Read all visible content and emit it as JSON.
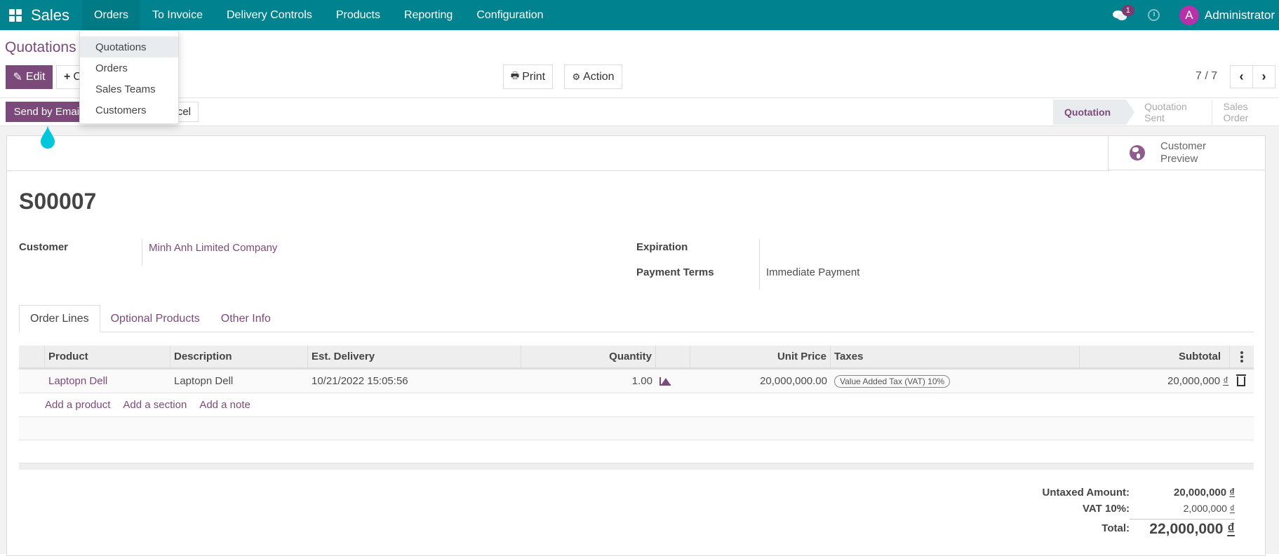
{
  "navbar": {
    "app_name": "Sales",
    "menus": [
      "Orders",
      "To Invoice",
      "Delivery Controls",
      "Products",
      "Reporting",
      "Configuration"
    ],
    "active_menu": "Orders",
    "chat_badge": "1",
    "user_initial": "A",
    "user_name": "Administrator"
  },
  "dropdown": {
    "items": [
      "Quotations",
      "Orders",
      "Sales Teams",
      "Customers"
    ],
    "highlighted": "Quotations"
  },
  "control_panel": {
    "breadcrumb": "Quotations /",
    "edit_label": "Edit",
    "create_label": "C",
    "print_label": "Print",
    "action_label": "Action",
    "pager": "7 / 7"
  },
  "statusbar": {
    "send_email_label": "Send by Email",
    "cancel_label": "Cancel",
    "cancel_visible": "cel",
    "stages": [
      "Quotation",
      "Quotation Sent",
      "Sales Order"
    ],
    "active_stage": "Quotation"
  },
  "form": {
    "customer_preview_label_1": "Customer",
    "customer_preview_label_2": "Preview",
    "name": "S00007",
    "customer_label": "Customer",
    "customer_value": "Minh Anh Limited Company",
    "expiration_label": "Expiration",
    "expiration_value": "",
    "payment_terms_label": "Payment Terms",
    "payment_terms_value": "Immediate Payment"
  },
  "tabs": [
    "Order Lines",
    "Optional Products",
    "Other Info"
  ],
  "order_lines": {
    "columns": [
      "Product",
      "Description",
      "Est. Delivery",
      "Quantity",
      "",
      "Unit Price",
      "Taxes",
      "Subtotal"
    ],
    "rows": [
      {
        "product": "Laptopn Dell",
        "description": "Laptopn Dell",
        "est_delivery": "10/21/2022 15:05:56",
        "quantity": "1.00",
        "unit_price": "20,000,000.00",
        "tax": "Value Added Tax (VAT) 10%",
        "subtotal": "20,000,000",
        "currency": "₫"
      }
    ],
    "add_product": "Add a product",
    "add_section": "Add a section",
    "add_note": "Add a note"
  },
  "totals": {
    "untaxed_label": "Untaxed Amount:",
    "untaxed_value": "20,000,000",
    "vat_label": "VAT 10%:",
    "vat_value": "2,000,000",
    "total_label": "Total:",
    "total_value": "22,000,000",
    "currency": "₫"
  },
  "colors": {
    "navbar": "#00838f",
    "primary": "#7c4a7a",
    "avatar": "#b731a9",
    "tip_droplet": "#00c7dc"
  }
}
